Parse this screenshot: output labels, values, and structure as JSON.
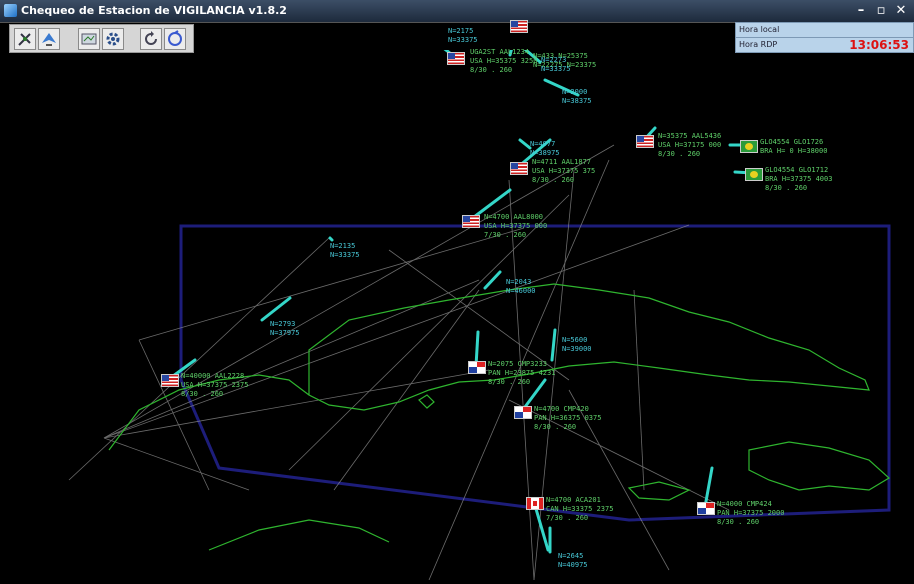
{
  "window": {
    "title": "Chequeo de Estacion de VIGILANCIA v1.8.2",
    "minimize": "–",
    "maximize": "▫",
    "close": "✕"
  },
  "toolbar": {
    "buttons": [
      {
        "name": "tool-radar-icon"
      },
      {
        "name": "tool-aircraft-icon"
      },
      {
        "name": "tool-map-icon"
      },
      {
        "name": "tool-settings-icon"
      },
      {
        "name": "tool-refresh-icon"
      },
      {
        "name": "tool-cycle-icon"
      }
    ]
  },
  "clock": {
    "local_label": "Hora local",
    "rdp_label": "Hora RDP",
    "rdp_value": "13:06:53"
  },
  "colors": {
    "land": "#2fb52f",
    "fir_boundary": "#1d1d7a",
    "airway": "#8f8f8f",
    "track": "#34d6c8",
    "label_green": "#5fd06a",
    "label_cyan": "#48c9d8"
  },
  "tracks": [
    {
      "id": "t1",
      "flag": "us",
      "l1": "UGA2ST  AAL1234",
      "l2": "USA  H=35375  3250",
      "l3": "8/30 . 260"
    },
    {
      "id": "t2",
      "flag": "us",
      "l1": "N=433  N=25375",
      "l2": "N=22275  N=23375",
      "l3": ""
    },
    {
      "id": "t3",
      "flag": "us",
      "l1": "N=35375  AAL5436",
      "l2": "USA  H=37175  000",
      "l3": "8/30 . 260"
    },
    {
      "id": "t4",
      "flag": "us",
      "l1": "N=4711  AAL1877",
      "l2": "USA  H=37375  375",
      "l3": "8/30 . 260"
    },
    {
      "id": "t5",
      "flag": "us",
      "l1": "N=4700  AAL8000",
      "l2": "USA  H=37375  000",
      "l3": "7/30 . 260"
    },
    {
      "id": "t6",
      "flag": "br",
      "l1": "GLO4554  GLO1726",
      "l2": "BRA  H=  0  H=38000",
      "l3": ""
    },
    {
      "id": "t7",
      "flag": "br",
      "l1": "GLO4554  GLO1712",
      "l2": "BRA  H=37375  4003",
      "l3": "8/30 . 260"
    },
    {
      "id": "t8",
      "flag": "us",
      "l1": "N=40000  AAL2228",
      "l2": "USA  H=37375  2375",
      "l3": "8/30 . 260"
    },
    {
      "id": "t9",
      "flag": "pa",
      "l1": "N=2075  CMP3233",
      "l2": "PAN  H=23875  4231",
      "l3": "8/30 . 260"
    },
    {
      "id": "t10",
      "flag": "pa",
      "l1": "N=4700  CMP420",
      "l2": "PAN  H=36375  0375",
      "l3": "8/30 . 260"
    },
    {
      "id": "t11",
      "flag": "ca",
      "l1": "N=4700  ACA201",
      "l2": "CAN  H=33375  2375",
      "l3": "7/30 . 260"
    },
    {
      "id": "t12",
      "flag": "pa",
      "l1": "N=4000  CMP424",
      "l2": "PAN  H=37375  2000",
      "l3": "8/30 . 260"
    }
  ],
  "tags": [
    {
      "id": "g1",
      "l1": "N=2175",
      "l2": "N=33375"
    },
    {
      "id": "g2",
      "l1": "N=2273",
      "l2": "N=33375"
    },
    {
      "id": "g3",
      "l1": "N=2000",
      "l2": "N=38375"
    },
    {
      "id": "g4",
      "l1": "N=2135",
      "l2": "N=33375"
    },
    {
      "id": "g5",
      "l1": "N=2793",
      "l2": "N=37975"
    },
    {
      "id": "g6",
      "l1": "N=5600",
      "l2": "N=39000"
    },
    {
      "id": "g7",
      "l1": "N=2645",
      "l2": "N=40975"
    },
    {
      "id": "g8",
      "l1": "N=2043",
      "l2": "N=46000"
    },
    {
      "id": "g9",
      "l1": "N=4077",
      "l2": "N=38975"
    }
  ]
}
